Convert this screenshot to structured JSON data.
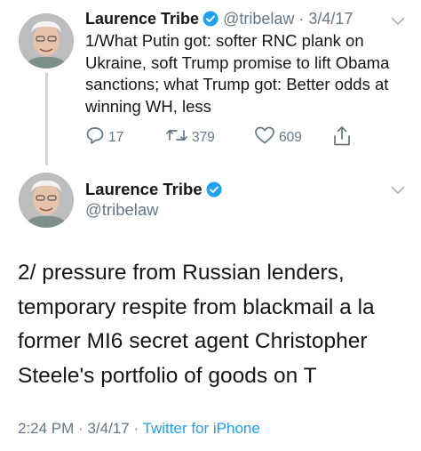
{
  "tweets": [
    {
      "author_name": "Laurence Tribe",
      "handle": "@tribelaw",
      "separator": "·",
      "date": "3/4/17",
      "text": "1/What Putin got: softer RNC plank on Ukraine, soft Trump promise to lift Obama sanctions; what Trump got: Better odds at winning WH, less",
      "replies": "17",
      "retweets": "379",
      "likes": "609"
    },
    {
      "author_name": "Laurence Tribe",
      "handle": "@tribelaw",
      "text": "2/ pressure from Russian lenders, temporary respite from blackmail a la former MI6 secret agent Christopher Steele's portfolio of goods on T",
      "time": "2:24 PM",
      "date": "3/4/17",
      "separator": "·",
      "source": "Twitter for iPhone"
    }
  ],
  "colors": {
    "verified": "#1da1f2",
    "link": "#1da1f2",
    "muted": "#657786",
    "text": "#14171a",
    "thread_line": "#ccd6dd"
  },
  "icons": [
    "avatar",
    "verified-badge-icon",
    "chevron-down-icon",
    "reply-icon",
    "retweet-icon",
    "like-icon",
    "share-icon"
  ]
}
